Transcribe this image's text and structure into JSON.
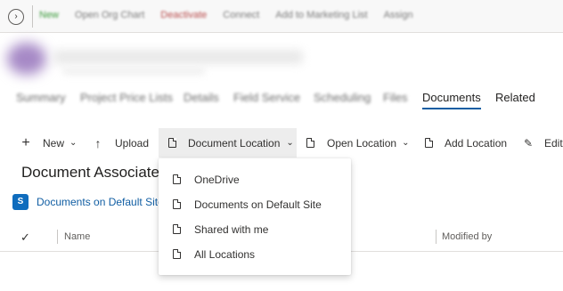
{
  "topbar": {
    "commands": [
      "New",
      "Open Org Chart",
      "Deactivate",
      "Connect",
      "Add to Marketing List",
      "Assign"
    ]
  },
  "tabs": {
    "items": [
      "Summary",
      "Project Price Lists",
      "Details",
      "Field Service",
      "Scheduling",
      "Files",
      "Documents",
      "Related"
    ],
    "active": "Documents"
  },
  "ribbon": {
    "new_label": "New",
    "upload_label": "Upload",
    "document_location_label": "Document Location",
    "open_location_label": "Open Location",
    "add_location_label": "Add Location",
    "edit_label": "Edit"
  },
  "section": {
    "title": "Document Associate"
  },
  "location_link": {
    "label": "Documents on Default Site"
  },
  "grid": {
    "columns": [
      "Name",
      "Modified by"
    ]
  },
  "dropdown": {
    "items": [
      "OneDrive",
      "Documents on Default Site",
      "Shared with me",
      "All Locations"
    ]
  },
  "colors": {
    "accent": "#115ea3",
    "sharepoint_icon": "#0f6cbd",
    "pressed_bg": "#ededed"
  },
  "icons": {
    "nav": "chevron-right-icon",
    "new": "plus-icon",
    "upload": "upload-arrow-icon",
    "document_location": "document-icon",
    "open_location": "folder-document-icon",
    "add_location": "document-icon",
    "edit": "pencil-icon",
    "sharepoint": "sharepoint-icon",
    "select_all": "checkmark-icon",
    "dropdown_item": "document-icon"
  }
}
